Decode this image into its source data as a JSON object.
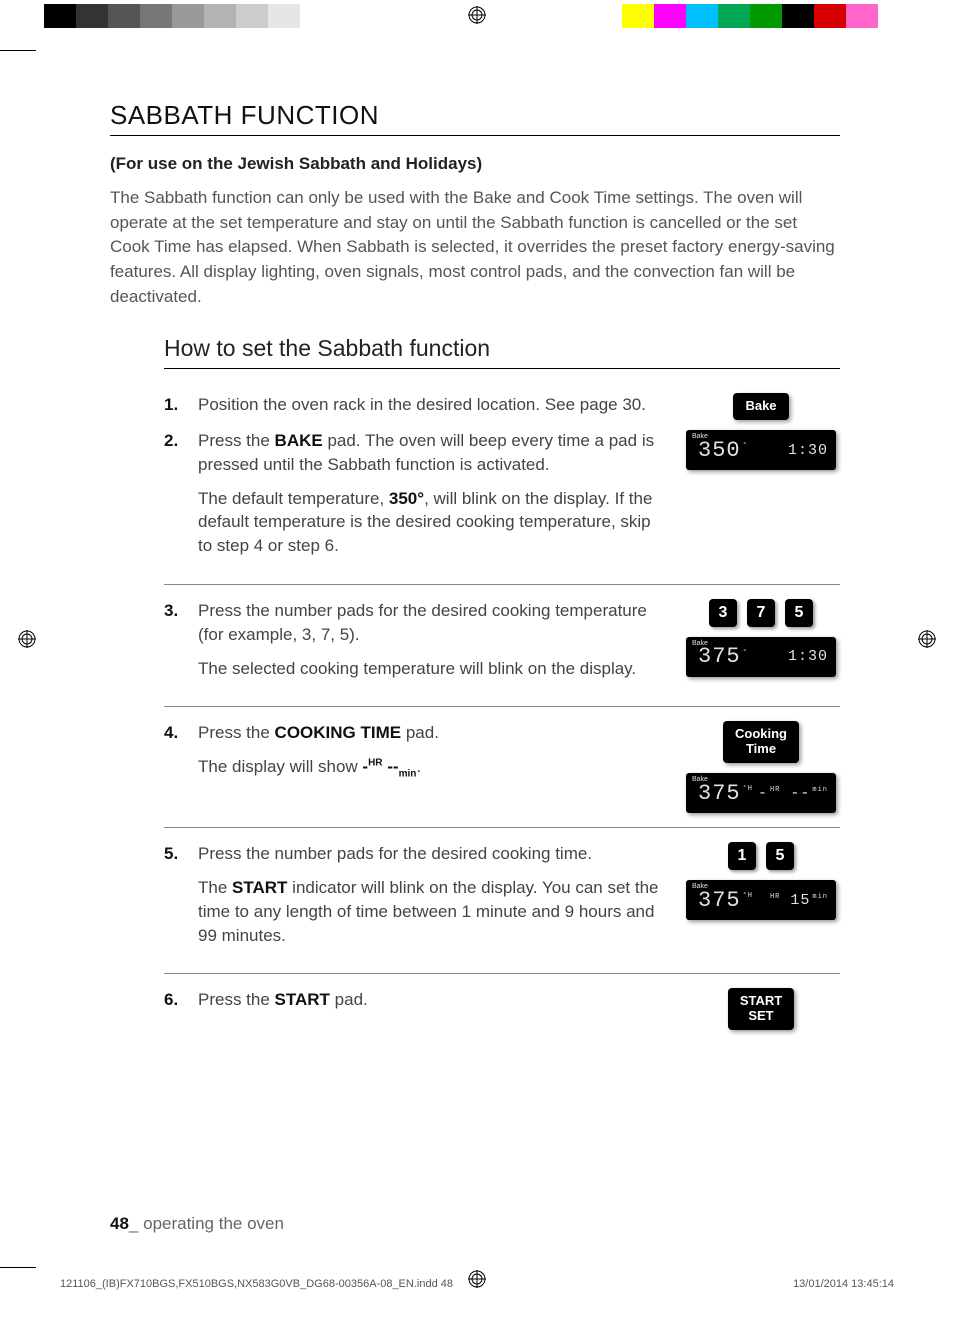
{
  "colorBar": {
    "left": [
      "#000000",
      "#333333",
      "#555555",
      "#777777",
      "#999999",
      "#b3b3b3",
      "#cccccc",
      "#e6e6e6",
      "#ffffff"
    ],
    "right": [
      "#ffff00",
      "#ff00ff",
      "#00bfff",
      "#00a651",
      "#009900",
      "#000000",
      "#d40000",
      "#ff66cc",
      "#ffffff"
    ]
  },
  "section": {
    "title": "SABBATH FUNCTION",
    "subtitle": "(For use on the Jewish Sabbath and Holidays)",
    "intro": "The Sabbath function can only be used with the Bake and Cook Time settings. The oven will operate at the set temperature and stay on until the Sabbath function is cancelled or the set Cook Time has elapsed. When Sabbath is selected, it overrides the preset factory energy-saving features. All display lighting, oven signals, most control pads, and the convection fan will be deactivated.",
    "subheading": "How to set the Sabbath function"
  },
  "steps": {
    "s1": {
      "num": "1.",
      "text": "Position the oven rack in the desired location. See page 30."
    },
    "s2": {
      "num": "2.",
      "text_a": "Press the ",
      "kw": "BAKE",
      "text_b": " pad. The oven will beep every time a pad is pressed until the Sabbath function is activated.",
      "sub_a": "The default temperature, ",
      "kw2": "350°",
      "sub_b": ", will blink on the display. If the default temperature is the desired cooking temperature, skip to step 4 or step 6."
    },
    "s3": {
      "num": "3.",
      "text": "Press the number pads for the desired cooking temperature (for example, 3, 7, 5).",
      "sub": "The selected cooking temperature will blink on the display."
    },
    "s4": {
      "num": "4.",
      "text_a": "Press the ",
      "kw": "COOKING TIME",
      "text_b": " pad.",
      "sub_a": "The display will show ",
      "sub_sym_dash1": "-",
      "sub_sup": "HR",
      "sub_sym_dash2": " --",
      "sub_sub": "min",
      "sub_period": "."
    },
    "s5": {
      "num": "5.",
      "text": "Press the number pads for the desired cooking time.",
      "sub_a": "The ",
      "kw": "START",
      "sub_b": " indicator will blink on the display. You can set the time to any length of time between 1 minute and 9 hours and 99 minutes."
    },
    "s6": {
      "num": "6.",
      "text_a": "Press the ",
      "kw": "START",
      "text_b": " pad."
    }
  },
  "graphics": {
    "bakePad": "Bake",
    "display1": {
      "label": "Bake",
      "temp": "350",
      "deg": "°",
      "right": "1:30"
    },
    "numpad3": [
      "3",
      "7",
      "5"
    ],
    "display2": {
      "label": "Bake",
      "temp": "375",
      "deg": "°",
      "right": "1:30"
    },
    "cookingTimePad_l1": "Cooking",
    "cookingTimePad_l2": "Time",
    "display3": {
      "label": "Bake",
      "temp": "375",
      "suf": "°H",
      "right_a": "-",
      "right_sup": "HR",
      "right_b": " --",
      "right_sub": "min"
    },
    "numpad5": [
      "1",
      "5"
    ],
    "display4": {
      "label": "Bake",
      "temp": "375",
      "suf": "°H",
      "right_sup": "HR",
      "right": " 15",
      "right_sub": "min"
    },
    "startPad_l1": "START",
    "startPad_l2": "SET"
  },
  "footer": {
    "pageNum": "48",
    "sep": "_ ",
    "label": "operating the oven"
  },
  "printInfo": {
    "left": "121106_(IB)FX710BGS,FX510BGS,NX583G0VB_DG68-00356A-08_EN.indd   48",
    "right": "13/01/2014   13:45:14"
  }
}
